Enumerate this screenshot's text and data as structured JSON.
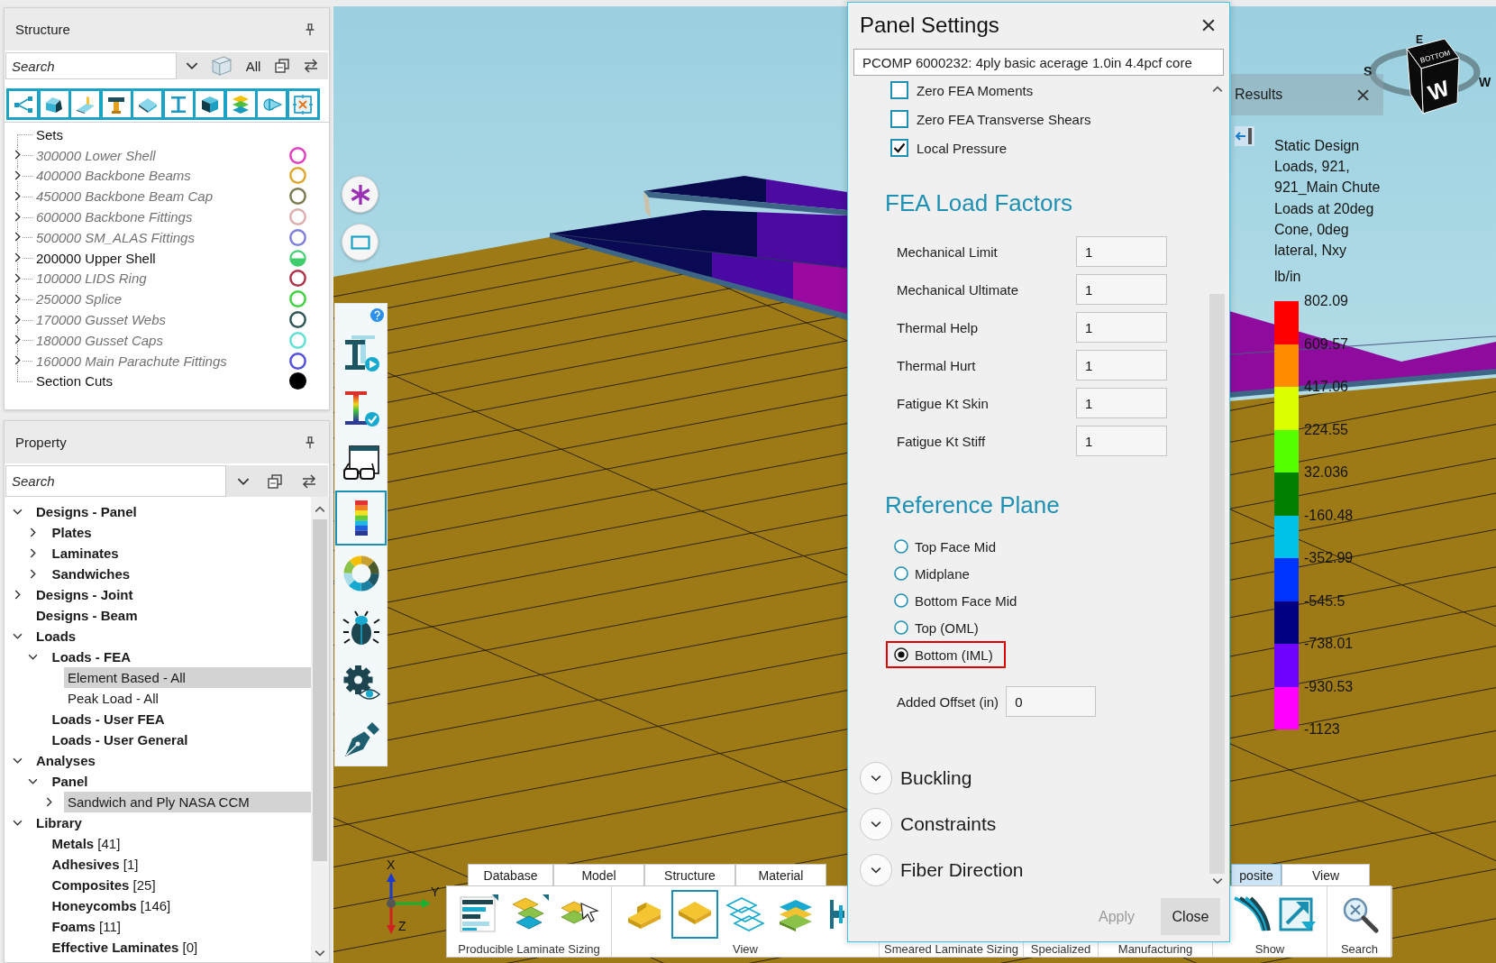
{
  "structure_panel": {
    "title": "Structure",
    "search": {
      "placeholder": "Search"
    },
    "filter": "All",
    "sets": {
      "label": "Sets",
      "items": [
        {
          "label": "300000 Lower Shell",
          "expanded": false,
          "shown": false,
          "kind": "ring",
          "color": "#e23fbf"
        },
        {
          "label": "400000 Backbone Beams",
          "expanded": false,
          "shown": false,
          "kind": "ring",
          "color": "#e0a72e"
        },
        {
          "label": "450000 Backbone Beam Cap",
          "expanded": false,
          "shown": false,
          "kind": "ring",
          "color": "#7b7a50"
        },
        {
          "label": "600000 Backbone Fittings",
          "expanded": false,
          "shown": false,
          "kind": "ring",
          "color": "#dcaeae"
        },
        {
          "label": "500000 SM_ALAS Fittings",
          "expanded": false,
          "shown": false,
          "kind": "ring",
          "color": "#7f7fe0"
        },
        {
          "label": "200000 Upper Shell",
          "expanded": false,
          "shown": true,
          "kind": "half",
          "color": "#3fcd6d"
        },
        {
          "label": "100000 LIDS Ring",
          "expanded": false,
          "shown": false,
          "kind": "ring",
          "color": "#b0334a"
        },
        {
          "label": "250000 Splice",
          "expanded": false,
          "shown": false,
          "kind": "ring",
          "color": "#3fd23f"
        },
        {
          "label": "170000 Gusset Webs",
          "expanded": false,
          "shown": false,
          "kind": "ring",
          "color": "#2f5656"
        },
        {
          "label": "180000 Gusset Caps",
          "expanded": false,
          "shown": false,
          "kind": "ring",
          "color": "#5fe0d2"
        },
        {
          "label": "160000 Main Parachute Fittings",
          "expanded": false,
          "shown": false,
          "kind": "ring",
          "color": "#4f4fe0"
        },
        {
          "label": "Section Cuts",
          "shown": true,
          "kind": "solid",
          "color": "#000000"
        }
      ]
    }
  },
  "property_panel": {
    "title": "Property",
    "search": {
      "placeholder": "Search"
    },
    "tree": [
      {
        "label": "Designs - Panel",
        "kind": "category",
        "expanded": true,
        "selected": false,
        "children": [
          {
            "label": "Plates",
            "kind": "category",
            "expanded": false,
            "selected": false
          },
          {
            "label": "Laminates",
            "kind": "category",
            "expanded": false,
            "selected": false
          },
          {
            "label": "Sandwiches",
            "kind": "category",
            "expanded": false,
            "selected": false
          }
        ]
      },
      {
        "label": "Designs - Joint",
        "kind": "category",
        "expanded": false,
        "selected": false
      },
      {
        "label": "Designs - Beam",
        "kind": "category",
        "selected": false
      },
      {
        "label": "Loads",
        "kind": "category",
        "expanded": true,
        "selected": false,
        "children": [
          {
            "label": "Loads - FEA",
            "kind": "category",
            "expanded": true,
            "selected": false,
            "children": [
              {
                "label": "Element Based - All",
                "kind": "item",
                "selected": true
              },
              {
                "label": "Peak Load - All",
                "kind": "item",
                "selected": false
              }
            ]
          },
          {
            "label": "Loads - User FEA",
            "kind": "category",
            "selected": false
          },
          {
            "label": "Loads - User General",
            "kind": "category",
            "selected": false
          }
        ]
      },
      {
        "label": "Analyses",
        "kind": "category",
        "expanded": true,
        "selected": false,
        "children": [
          {
            "label": "Panel",
            "kind": "category",
            "expanded": true,
            "selected": false,
            "children": [
              {
                "label": "Sandwich and Ply NASA CCM",
                "kind": "item",
                "expanded": false,
                "selected": true
              }
            ]
          }
        ]
      },
      {
        "label": "Library",
        "kind": "category",
        "expanded": true,
        "selected": false,
        "children": [
          {
            "label": "**Metals** [41]",
            "kind": "item",
            "selected": false
          },
          {
            "label": "**Adhesives** [1]",
            "kind": "item",
            "selected": false
          },
          {
            "label": "**Composites** [25]",
            "kind": "item",
            "selected": false
          },
          {
            "label": "**Honeycombs** [146]",
            "kind": "item",
            "selected": false
          },
          {
            "label": "**Foams** [11]",
            "kind": "item",
            "selected": false
          },
          {
            "label": "**Effective Laminates** [0]",
            "kind": "item",
            "selected": false
          }
        ]
      }
    ]
  },
  "viewport": {
    "tools": [
      {
        "selected": false
      },
      {
        "selected": false
      },
      {
        "selected": false
      },
      {
        "selected": true
      },
      {
        "selected": false
      },
      {
        "selected": false
      },
      {
        "selected": false
      },
      {
        "selected": false
      }
    ],
    "axes": [
      "X",
      "Y",
      "Z"
    ],
    "view_cube": {
      "face_labels": [
        "BOTTOM",
        "W"
      ],
      "compass_labels": [
        "S",
        "E",
        "W"
      ]
    }
  },
  "panel_settings": {
    "title": "Panel Settings",
    "selector": "PCOMP 6000232: 4ply basic acerage 1.0in 4.4pcf core",
    "options": [
      {
        "label": "Zero FEA Moments",
        "checked": false
      },
      {
        "label": "Zero FEA Transverse Shears",
        "checked": false
      },
      {
        "label": "Local Pressure",
        "checked": true
      }
    ],
    "load_factors": {
      "title": "FEA Load Factors",
      "fields": [
        {
          "label": "Mechanical Limit",
          "value": "1"
        },
        {
          "label": "Mechanical Ultimate",
          "value": "1"
        },
        {
          "label": "Thermal Help",
          "value": "1"
        },
        {
          "label": "Thermal Hurt",
          "value": "1"
        },
        {
          "label": "Fatigue Kt Skin",
          "value": "1"
        },
        {
          "label": "Fatigue Kt Stiff",
          "value": "1"
        }
      ]
    },
    "reference_plane": {
      "title": "Reference Plane",
      "options": [
        {
          "label": "Top Face Mid",
          "selected": false,
          "highlighted": false
        },
        {
          "label": "Midplane",
          "selected": false,
          "highlighted": false
        },
        {
          "label": "Bottom Face Mid",
          "selected": false,
          "highlighted": false
        },
        {
          "label": "Top (OML)",
          "selected": false,
          "highlighted": false
        },
        {
          "label": "Bottom (IML)",
          "selected": true,
          "highlighted": true
        }
      ],
      "offset": {
        "label": "Added Offset (in)",
        "value": "0"
      }
    },
    "sections": [
      {
        "label": "Buckling",
        "expanded": false
      },
      {
        "label": "Constraints",
        "expanded": false
      },
      {
        "label": "Fiber Direction",
        "expanded": false
      }
    ],
    "buttons": [
      {
        "label": "Apply",
        "disabled": true
      },
      {
        "label": "Close",
        "disabled": false
      }
    ]
  },
  "results": {
    "title": "Results",
    "legend": {
      "title_lines": [
        "Static Design",
        "Loads, 921,",
        "921_Main Chute",
        "Loads at 20deg",
        "Cone, 0deg",
        "lateral, Nxy"
      ],
      "unit": "lb/in",
      "bands": [
        {
          "color": "#ff0000"
        },
        {
          "color": "#ff8c00"
        },
        {
          "color": "#dcff00"
        },
        {
          "color": "#55ff00"
        },
        {
          "color": "#008000"
        },
        {
          "color": "#00c2e8"
        },
        {
          "color": "#0033ff"
        },
        {
          "color": "#000080"
        },
        {
          "color": "#7000ff"
        },
        {
          "color": "#ff00ff"
        }
      ],
      "ticks": [
        "802.09",
        "609.57",
        "417.06",
        "224.55",
        "32.036",
        "-160.48",
        "-352.99",
        "-545.5",
        "-738.01",
        "-930.53",
        "-1123"
      ]
    }
  },
  "ribbon": {
    "tabs": [
      {
        "label": "Database",
        "selected": false
      },
      {
        "label": "Model",
        "selected": false
      },
      {
        "label": "Structure",
        "selected": false
      },
      {
        "label": "Material",
        "selected": false
      },
      {
        "label": "posite",
        "selected": true
      },
      {
        "label": "View",
        "selected": false
      }
    ],
    "groups": [
      {
        "label": "Producible Laminate Sizing",
        "buttons": [
          {
            "selected": false
          },
          {
            "selected": false
          },
          {
            "selected": false
          }
        ]
      },
      {
        "label": "View",
        "buttons": [
          {
            "selected": false
          },
          {
            "selected": true
          },
          {
            "selected": false
          },
          {
            "selected": false
          },
          {
            "selected": false
          }
        ]
      },
      {
        "label": "Smeared Laminate Sizing"
      },
      {
        "label": "Specialized"
      },
      {
        "label": "Manufacturing"
      },
      {
        "label": "Show",
        "buttons": [
          {
            "selected": false
          },
          {
            "selected": false
          }
        ]
      },
      {
        "label": "Search",
        "buttons": [
          {
            "selected": false
          }
        ]
      }
    ]
  }
}
